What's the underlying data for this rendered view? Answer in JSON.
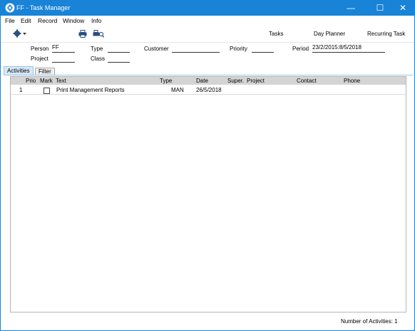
{
  "window": {
    "title": "FF - Task Manager"
  },
  "titlebar": {
    "minimize": "—",
    "maximize": "☐",
    "close": "✕"
  },
  "menu": [
    "File",
    "Edit",
    "Record",
    "Window",
    "Info"
  ],
  "toolbar": {
    "tasks": "Tasks",
    "day_planner": "Day Planner",
    "recurring_task": "Recurring Task"
  },
  "filters": {
    "person_label": "Person",
    "person_value": "FF",
    "type_label": "Type",
    "type_value": "",
    "customer_label": "Customer",
    "customer_value": "",
    "priority_label": "Priority",
    "priority_value": "",
    "period_label": "Period",
    "period_value": "23/2/2015:8/5/2018",
    "project_label": "Project",
    "project_value": "",
    "class_label": "Class",
    "class_value": ""
  },
  "tabs": [
    "Activities",
    "Filter"
  ],
  "table": {
    "columns": [
      "Prio",
      "Mark",
      "Text",
      "Type",
      "Date",
      "Super.",
      "Project",
      "Contact",
      "Phone"
    ],
    "rows": [
      {
        "prio": "1",
        "mark": false,
        "text": "Print Management Reports",
        "type": "MAN",
        "date": "26/5/2018",
        "super": "",
        "project": "",
        "contact": "",
        "phone": ""
      }
    ]
  },
  "footer": {
    "count_text": "Number of Activities: 1"
  }
}
